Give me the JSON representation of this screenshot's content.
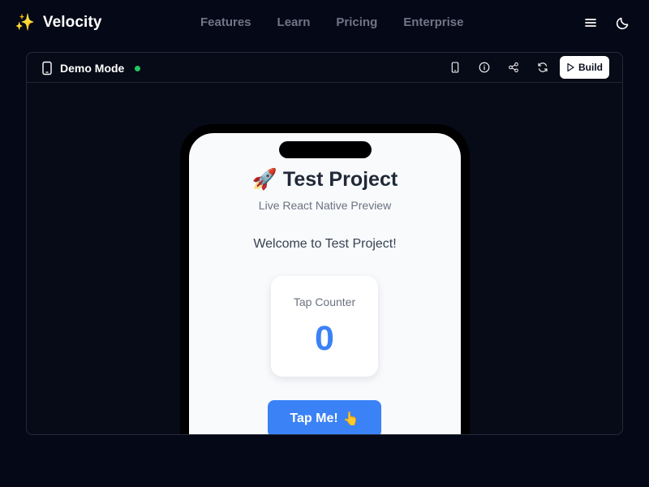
{
  "brand": {
    "icon": "sparkles-icon",
    "icon_glyph": "✨",
    "name": "Velocity"
  },
  "nav": {
    "items": [
      {
        "label": "Features"
      },
      {
        "label": "Learn"
      },
      {
        "label": "Pricing"
      },
      {
        "label": "Enterprise"
      }
    ]
  },
  "top_actions": {
    "menu_icon": "menu-icon",
    "theme_icon": "moon-icon"
  },
  "demo": {
    "device_icon": "phone-icon",
    "title": "Demo Mode",
    "status": "online",
    "status_color": "#22c55e",
    "actions": [
      {
        "icon": "phone-icon"
      },
      {
        "icon": "info-icon"
      },
      {
        "icon": "share-icon"
      },
      {
        "icon": "refresh-icon"
      }
    ],
    "build_button": {
      "icon": "play-icon",
      "label": "Build"
    }
  },
  "preview": {
    "title_icon_glyph": "🚀",
    "title": "Test Project",
    "subtitle": "Live React Native Preview",
    "welcome": "Welcome to Test Project!",
    "counter": {
      "label": "Tap Counter",
      "value": "0"
    },
    "button": {
      "label": "Tap Me!",
      "icon_glyph": "👆"
    }
  },
  "colors": {
    "background": "#050816",
    "accent": "#3b82f6",
    "status": "#22c55e"
  }
}
